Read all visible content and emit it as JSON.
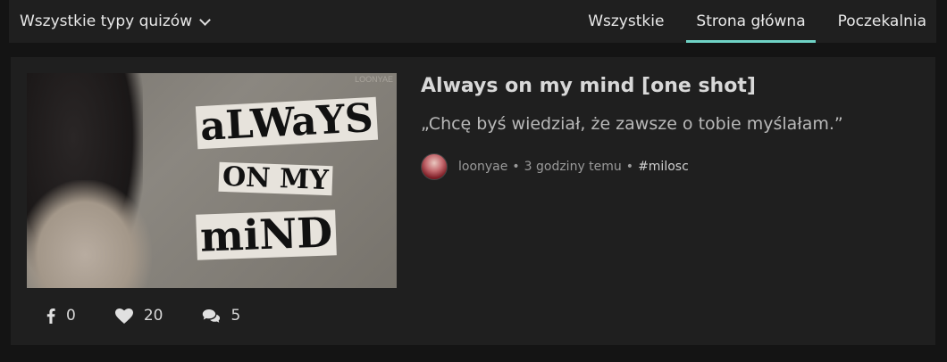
{
  "topbar": {
    "filter_label": "Wszystkie typy quizów",
    "tabs": [
      {
        "label": "Wszystkie"
      },
      {
        "label": "Strona główna"
      },
      {
        "label": "Poczekalnia"
      }
    ],
    "accent_color": "#6fd3c6"
  },
  "post": {
    "title": "Always on my mind [one shot]",
    "description": "„Chcę byś wiedział, że zawsze o tobie myślałam.”",
    "author": "loonyae",
    "separator": "•",
    "time": "3 godziny temu",
    "tag": "#milosc",
    "thumbnail": {
      "watermark": "LOONYAE",
      "lines": [
        "aLWaYS",
        "ON MY",
        "miND"
      ]
    },
    "stats": {
      "shares": "0",
      "likes": "20",
      "comments": "5"
    }
  }
}
